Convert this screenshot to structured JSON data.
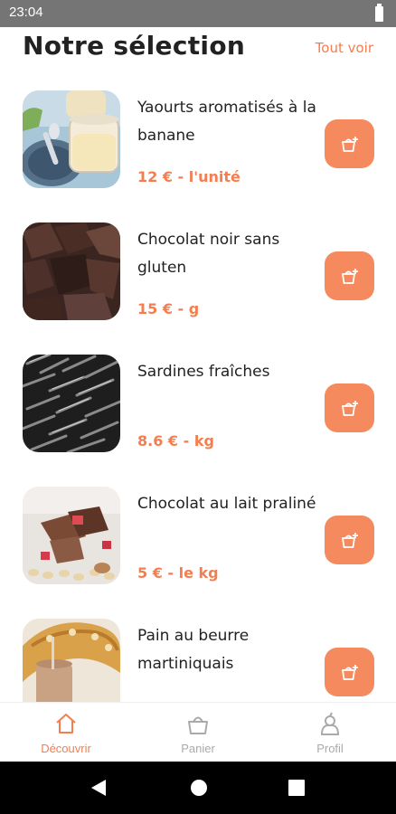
{
  "status_bar": {
    "time": "23:04"
  },
  "header": {
    "title": "Notre sélection",
    "see_all": "Tout voir"
  },
  "products": [
    {
      "name": "Yaourts aromatisés à la banane",
      "price": "12 € - l'unité",
      "image": "yogurt-jars-photo"
    },
    {
      "name": "Chocolat noir sans gluten",
      "price": "15 € - g",
      "image": "dark-chocolate-photo"
    },
    {
      "name": "Sardines fraîches",
      "price": "8.6 € - kg",
      "image": "sardines-photo"
    },
    {
      "name": "Chocolat au lait praliné",
      "price": "5 € - le kg",
      "image": "praline-chocolate-photo"
    },
    {
      "name": "Pain au beurre martiniquais",
      "price": "",
      "image": "butter-bread-photo"
    }
  ],
  "add_button_icon": "basket-add-icon",
  "bottom_nav": [
    {
      "label": "Découvrir",
      "icon": "home-icon",
      "active": true
    },
    {
      "label": "Panier",
      "icon": "basket-icon",
      "active": false
    },
    {
      "label": "Profil",
      "icon": "pear-icon",
      "active": false
    }
  ],
  "colors": {
    "accent": "#F47E4F",
    "button": "#F58A5E",
    "status_bar": "#757575"
  }
}
